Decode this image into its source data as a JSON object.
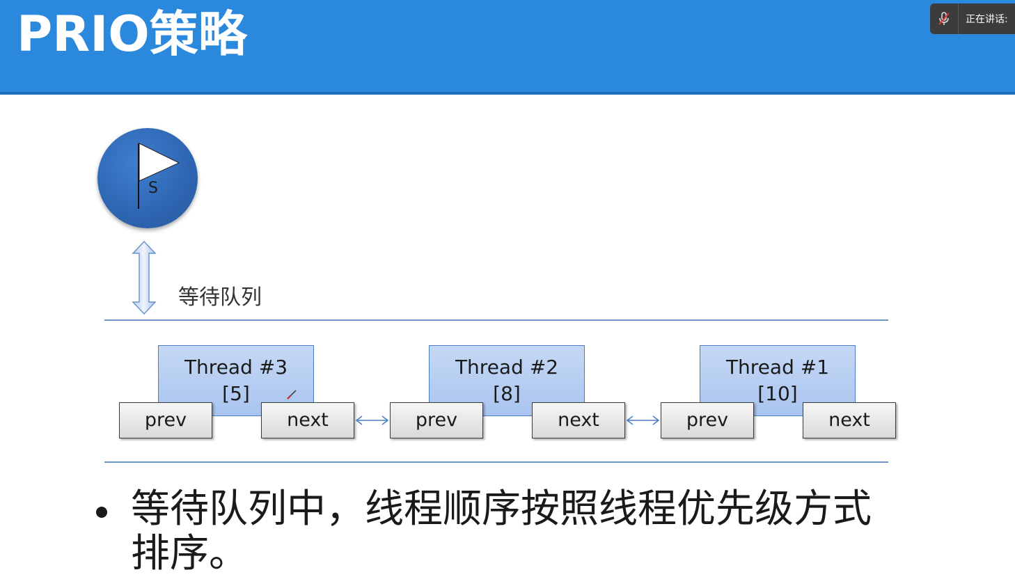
{
  "slide": {
    "title": "PRIO策略",
    "speaker_label": "正在讲话:",
    "flag_letter": "S",
    "queue_label": "等待队列",
    "threads": [
      {
        "name": "Thread #3",
        "priority": "[5]",
        "prev": "prev",
        "next": "next"
      },
      {
        "name": "Thread #2",
        "priority": "[8]",
        "prev": "prev",
        "next": "next"
      },
      {
        "name": "Thread #1",
        "priority": "[10]",
        "prev": "prev",
        "next": "next"
      }
    ],
    "bullet": "等待队列中，线程顺序按照线程优先级方式排序。"
  },
  "colors": {
    "header": "#2a89dc",
    "thread_fill": "#b4ccf2",
    "thread_border": "#4a7cc4",
    "pointer_fill": "#e6e6e6",
    "rule": "#6e95c8",
    "circle": "#2f67b4"
  },
  "icons": {
    "mic": "mic-muted-icon",
    "flag": "flag-icon",
    "vertical_arrow": "double-arrow-vertical-icon",
    "link_arrow": "double-arrow-horizontal-icon",
    "pen": "pen-cursor-icon"
  }
}
